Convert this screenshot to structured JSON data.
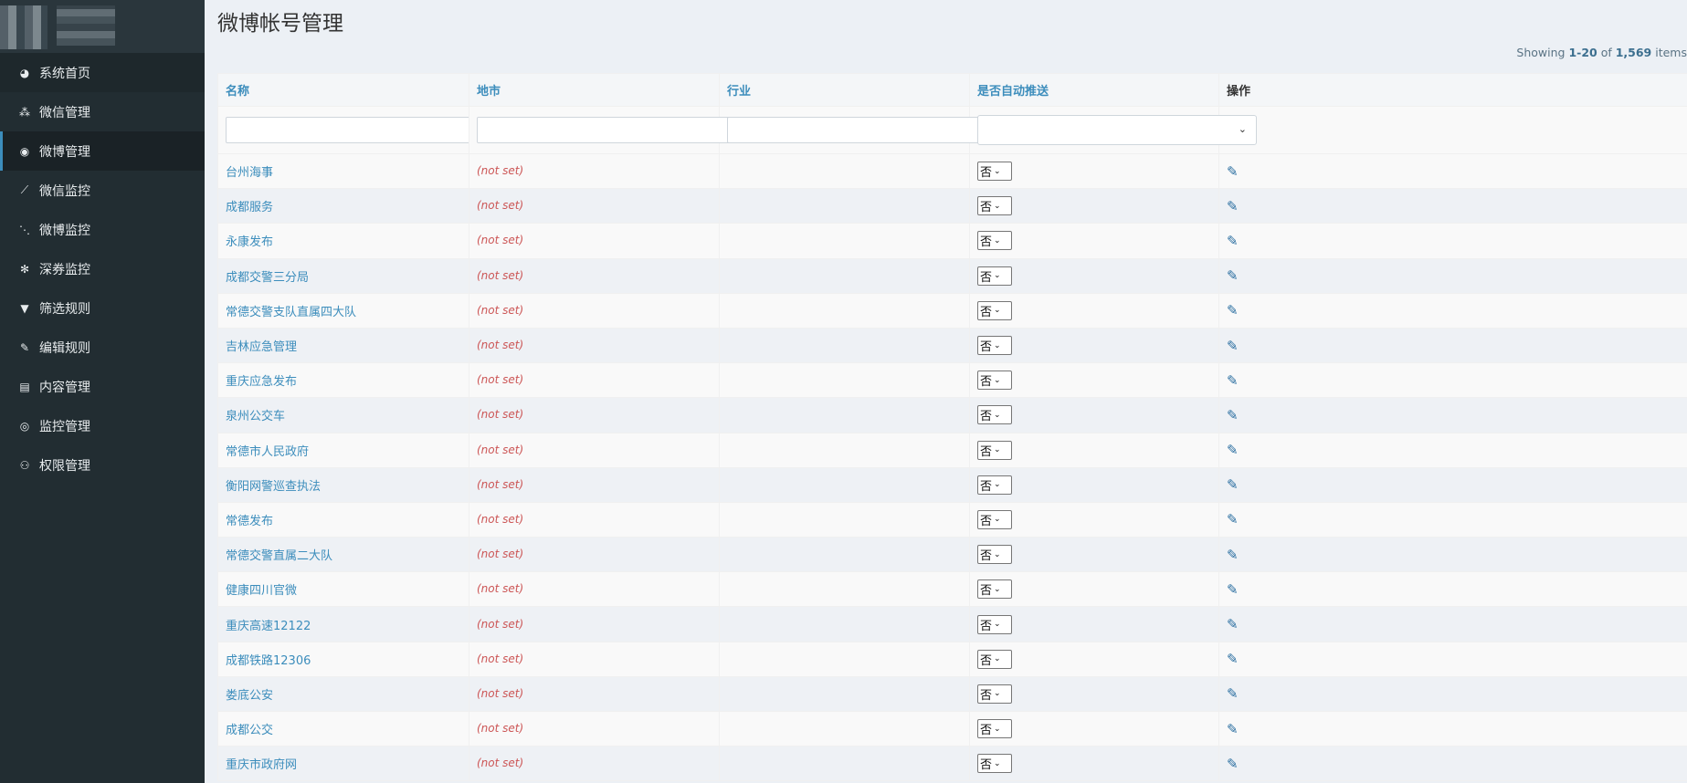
{
  "sidebar": {
    "items": [
      {
        "label": "系统首页",
        "icon": "dashboard-icon",
        "glyph": "◕"
      },
      {
        "label": "微信管理",
        "icon": "wechat-icon",
        "glyph": "⁂"
      },
      {
        "label": "微博管理",
        "icon": "weibo-icon",
        "glyph": "◉"
      },
      {
        "label": "微信监控",
        "icon": "line-chart-icon",
        "glyph": "⟋"
      },
      {
        "label": "微博监控",
        "icon": "rss-icon",
        "glyph": "⋱"
      },
      {
        "label": "深券监控",
        "icon": "paw-icon",
        "glyph": "✻"
      },
      {
        "label": "筛选规则",
        "icon": "filter-icon",
        "glyph": "▼"
      },
      {
        "label": "编辑规则",
        "icon": "edit-square-icon",
        "glyph": "✎"
      },
      {
        "label": "内容管理",
        "icon": "file-icon",
        "glyph": "▤"
      },
      {
        "label": "监控管理",
        "icon": "eye-icon",
        "glyph": "◎"
      },
      {
        "label": "权限管理",
        "icon": "users-icon",
        "glyph": "⚇"
      }
    ]
  },
  "page": {
    "title": "微博帐号管理",
    "summary": {
      "prefix": "Showing ",
      "range": "1-20",
      "of": " of ",
      "total": "1,569",
      "suffix": " items"
    }
  },
  "table": {
    "headers": [
      "名称",
      "地市",
      "行业",
      "是否自动推送",
      "操作"
    ],
    "rows": [
      {
        "name": "台州海事",
        "city": "(not set)",
        "auto": "否"
      },
      {
        "name": "成都服务",
        "city": "(not set)",
        "auto": "否"
      },
      {
        "name": "永康发布",
        "city": "(not set)",
        "auto": "否"
      },
      {
        "name": "成都交警三分局",
        "city": "(not set)",
        "auto": "否"
      },
      {
        "name": "常德交警支队直属四大队",
        "city": "(not set)",
        "auto": "否"
      },
      {
        "name": "吉林应急管理",
        "city": "(not set)",
        "auto": "否"
      },
      {
        "name": "重庆应急发布",
        "city": "(not set)",
        "auto": "否"
      },
      {
        "name": "泉州公交车",
        "city": "(not set)",
        "auto": "否"
      },
      {
        "name": "常德市人民政府",
        "city": "(not set)",
        "auto": "否"
      },
      {
        "name": "衡阳网警巡查执法",
        "city": "(not set)",
        "auto": "否"
      },
      {
        "name": "常德发布",
        "city": "(not set)",
        "auto": "否"
      },
      {
        "name": "常德交警直属二大队",
        "city": "(not set)",
        "auto": "否"
      },
      {
        "name": "健康四川官微",
        "city": "(not set)",
        "auto": "否"
      },
      {
        "name": "重庆高速12122",
        "city": "(not set)",
        "auto": "否"
      },
      {
        "name": "成都铁路12306",
        "city": "(not set)",
        "auto": "否"
      },
      {
        "name": "娄底公安",
        "city": "(not set)",
        "auto": "否"
      },
      {
        "name": "成都公交",
        "city": "(not set)",
        "auto": "否"
      },
      {
        "name": "重庆市政府网",
        "city": "(not set)",
        "auto": "否"
      }
    ]
  },
  "colors": {
    "sidebar_bg": "#222d32",
    "accent": "#3c8dbc",
    "notset": "#cc5555"
  }
}
